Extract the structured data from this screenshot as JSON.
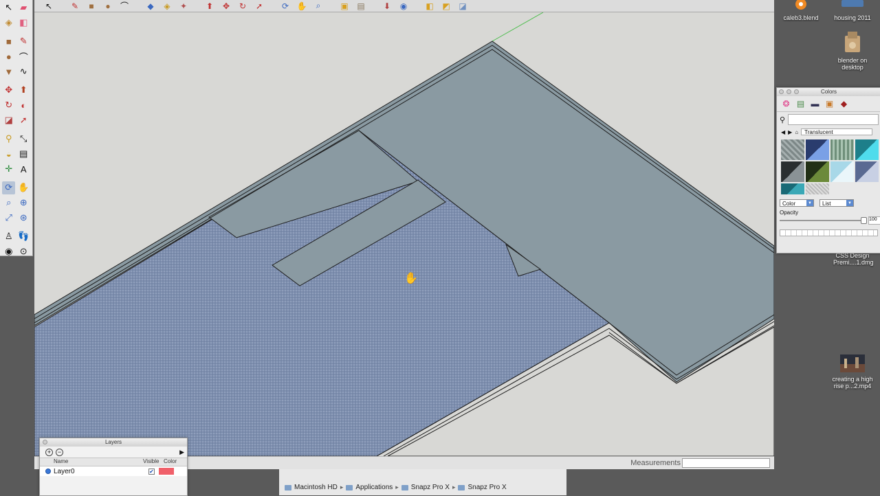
{
  "toolbar": {
    "icons": [
      "select-arrow-icon",
      "pencil-icon",
      "rectangle-icon",
      "circle-icon",
      "arc-icon",
      "eraser-icon",
      "tape-measure-icon",
      "paint-bucket-icon",
      "push-pull-icon",
      "rotate-icon",
      "follow-me-icon",
      "offset-icon",
      "orbit-icon",
      "pan-icon",
      "zoom-icon",
      "previous-view-icon",
      "next-view-icon",
      "get-models-icon",
      "share-model-icon",
      "components-icon",
      "extension-icon",
      "warehouse-icon"
    ]
  },
  "layers": {
    "title": "Layers",
    "add": "+",
    "remove": "−",
    "columns": {
      "name": "Name",
      "visible": "Visible",
      "color": "Color"
    },
    "rows": [
      {
        "name": "Layer0",
        "visible": true,
        "color": "#f0606a"
      }
    ]
  },
  "colors": {
    "title": "Colors",
    "library": "Translucent",
    "color_select": "Color",
    "list_select": "List",
    "opacity_label": "Opacity",
    "opacity_value": "100",
    "swatches": [
      "#8f9a9a",
      "#4c6fb3",
      "#7f9f8c",
      "#2eb6c6",
      "#3f4447",
      "#4a5f2b",
      "#d7eef6",
      "#3c4a6e",
      "#2f8590",
      "#c8c8c8"
    ]
  },
  "status": {
    "measurements_label": "Measurements",
    "measurements_value": ""
  },
  "finder": {
    "path": [
      "Macintosh HD",
      "Applications",
      "Snapz Pro X",
      "Snapz Pro X"
    ]
  },
  "desktop": {
    "items": [
      {
        "label": "caleb3.blend"
      },
      {
        "label": "housing 2011"
      },
      {
        "label": "blender on desktop"
      },
      {
        "label": "CSS Design Premi....1.dmg"
      },
      {
        "label": "creating a high rise p...2.mp4"
      }
    ]
  }
}
